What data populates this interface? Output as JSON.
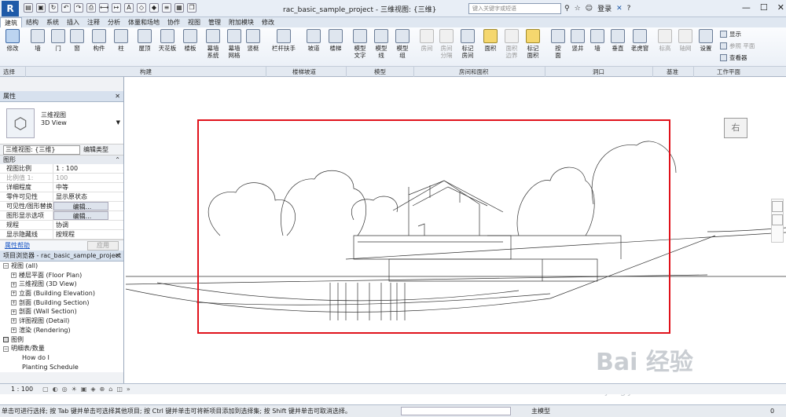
{
  "app": {
    "logo": "R",
    "window_title": "rac_basic_sample_project - 三维视图: {三维}",
    "search_placeholder": "键入关键字或短语",
    "login_label": "登录"
  },
  "tabs": [
    "建筑",
    "结构",
    "系统",
    "插入",
    "注释",
    "分析",
    "体量和场地",
    "协作",
    "视图",
    "管理",
    "附加模块",
    "修改"
  ],
  "ribbon": {
    "buttons": [
      {
        "label": "修改"
      },
      {
        "label": "墙"
      },
      {
        "label": "门"
      },
      {
        "label": "窗"
      },
      {
        "label": "构件"
      },
      {
        "label": "柱"
      },
      {
        "label": "屋顶"
      },
      {
        "label": "天花板"
      },
      {
        "label": "楼板"
      },
      {
        "label": "幕墙\n系统"
      },
      {
        "label": "幕墙\n网格"
      },
      {
        "label": "竖梃"
      },
      {
        "label": "栏杆扶手"
      },
      {
        "label": "坡道"
      },
      {
        "label": "楼梯"
      },
      {
        "label": "模型\n文字"
      },
      {
        "label": "模型\n线"
      },
      {
        "label": "模型\n组"
      },
      {
        "label": "房间"
      },
      {
        "label": "房间\n分隔"
      },
      {
        "label": "标记\n房间"
      },
      {
        "label": "面积"
      },
      {
        "label": "面积\n边界"
      },
      {
        "label": "标记\n面积"
      },
      {
        "label": "按\n面"
      },
      {
        "label": "竖井"
      },
      {
        "label": "墙"
      },
      {
        "label": "垂直"
      },
      {
        "label": "老虎窗"
      },
      {
        "label": "标高"
      },
      {
        "label": "轴网"
      },
      {
        "label": "设置"
      }
    ],
    "panels": [
      "选择",
      "构建",
      "楼梯坡道",
      "模型",
      "房间和面积",
      "洞口",
      "基准",
      "工作平面"
    ],
    "workplane_small": [
      "显示",
      "参照 平面",
      "查看器"
    ]
  },
  "properties": {
    "header": "属性",
    "type_name_line1": "三维视图",
    "type_name_line2": "3D View",
    "selector_value": "三维视图: {三维}",
    "edit_type_label": "编辑类型",
    "group_label": "图形",
    "rows": [
      {
        "k": "视图比例",
        "v": "1 : 100",
        "btn": false,
        "grey": false
      },
      {
        "k": "比例值 1:",
        "v": "100",
        "btn": false,
        "grey": true
      },
      {
        "k": "详细程度",
        "v": "中等",
        "btn": false,
        "grey": false
      },
      {
        "k": "零件可见性",
        "v": "显示原状态",
        "btn": false,
        "grey": false
      },
      {
        "k": "可见性/图形替换",
        "v": "编辑...",
        "btn": true,
        "grey": false
      },
      {
        "k": "图形显示选项",
        "v": "编辑...",
        "btn": true,
        "grey": false
      },
      {
        "k": "规程",
        "v": "协调",
        "btn": false,
        "grey": false
      },
      {
        "k": "显示隐藏线",
        "v": "按规程",
        "btn": false,
        "grey": false
      }
    ],
    "help_link": "属性帮助",
    "apply_label": "应用"
  },
  "browser": {
    "header": "项目浏览器 - rac_basic_sample_project",
    "nodes": [
      {
        "label": "视图 (all)",
        "indent": 0,
        "toggle": "-"
      },
      {
        "label": "楼层平面 (Floor Plan)",
        "indent": 1,
        "toggle": "+"
      },
      {
        "label": "三维视图 (3D View)",
        "indent": 1,
        "toggle": "+"
      },
      {
        "label": "立面 (Building Elevation)",
        "indent": 1,
        "toggle": "+"
      },
      {
        "label": "剖面 (Building Section)",
        "indent": 1,
        "toggle": "+"
      },
      {
        "label": "剖面 (Wall Section)",
        "indent": 1,
        "toggle": "+"
      },
      {
        "label": "详图视图 (Detail)",
        "indent": 1,
        "toggle": "+"
      },
      {
        "label": "渲染 (Rendering)",
        "indent": 1,
        "toggle": "+"
      },
      {
        "label": "图例",
        "indent": 0,
        "toggle": ""
      },
      {
        "label": "明细表/数量",
        "indent": 0,
        "toggle": "-"
      },
      {
        "label": "How do I",
        "indent": 2,
        "toggle": ""
      },
      {
        "label": "Planting Schedule",
        "indent": 2,
        "toggle": ""
      }
    ]
  },
  "view_control": {
    "scale": "1 : 100"
  },
  "viewcube": {
    "face_label": "右"
  },
  "statusbar": {
    "message": "单击可进行选择; 按 Tab 键并单击可选择其他项目; 按 Ctrl 键并单击可将新项目添加到选择集; 按 Shift 键并单击可取消选择。",
    "model_label": "主模型",
    "count": "0"
  },
  "watermark": {
    "text": "Bai 经验",
    "sub": "jingyan.baidu.com"
  },
  "colors": {
    "highlight_box": "#e0121b",
    "accent": "#1e5aa8"
  }
}
